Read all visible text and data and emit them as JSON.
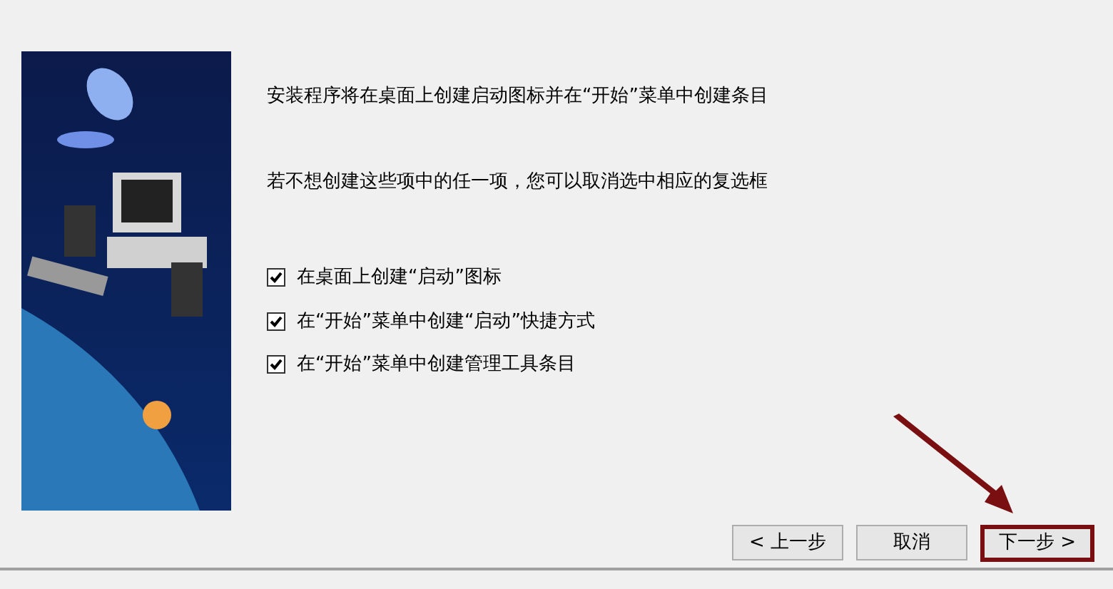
{
  "messages": [
    "安装程序将在桌面上创建启动图标并在“开始”菜单中创建条目",
    "若不想创建这些项中的任一项，您可以取消选中相应的复选框"
  ],
  "options": [
    {
      "label": "在桌面上创建“启动”图标",
      "checked": true
    },
    {
      "label": "在“开始”菜单中创建“启动”快捷方式",
      "checked": true
    },
    {
      "label": "在“开始”菜单中创建管理工具条目",
      "checked": true
    }
  ],
  "buttons": [
    {
      "label": "< 上一步",
      "highlighted": false
    },
    {
      "label": "取消",
      "highlighted": false
    },
    {
      "label": "下一步 >",
      "highlighted": true
    }
  ]
}
